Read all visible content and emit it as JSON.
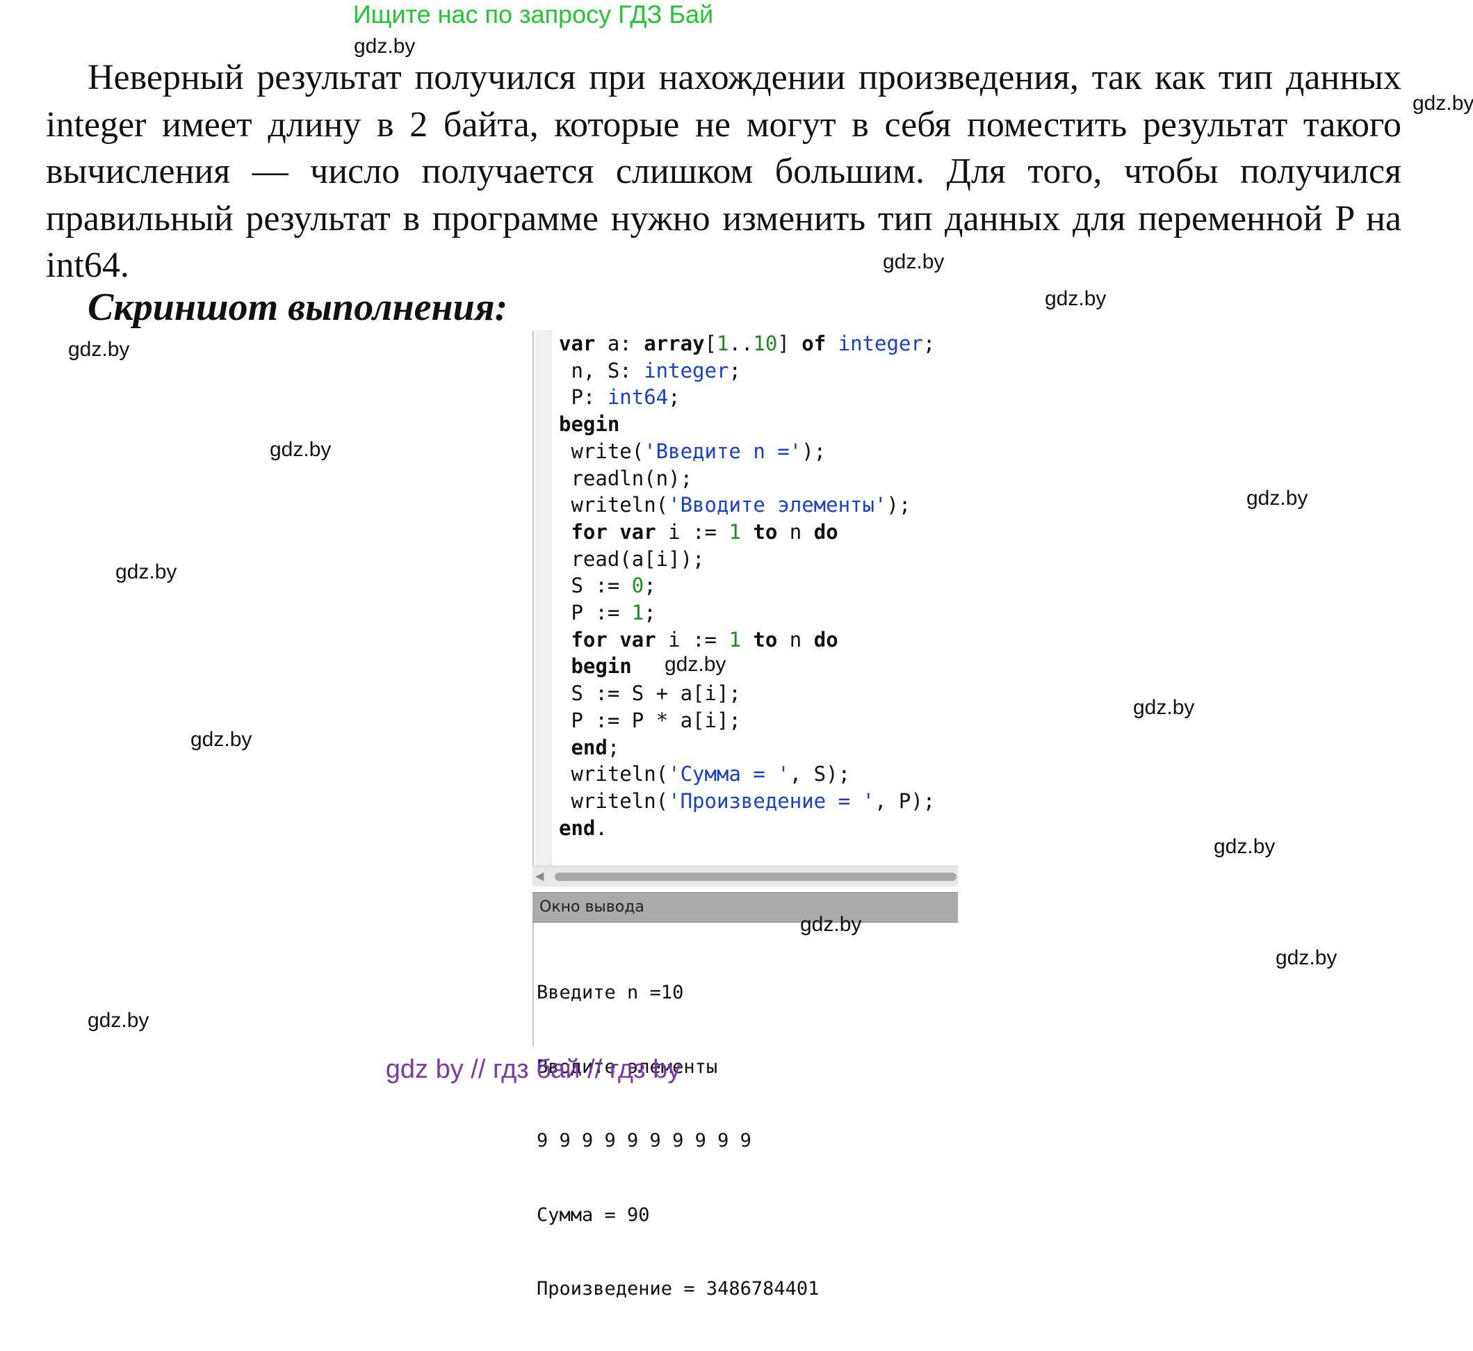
{
  "banner": "Ищите нас по запросу ГДЗ Бай",
  "watermark": "gdz.by",
  "paragraph": "Неверный результат получился при нахождении произведения, так как тип данных integer имеет длину в 2 байта, которые не могут в себя поместить результат такого вычисления — число получается слишком большим. Для того, чтобы получился правильный результат в программе нужно изменить тип данных для переменной P  на int64.",
  "heading": "Скриншот выполнения:",
  "code_lines": [
    "var a: array[1..10] of integer;",
    " n, S: integer;",
    " P: int64;",
    "begin",
    " write('Введите n =');",
    " readln(n);",
    " writeln('Вводите элементы');",
    " for var i := 1 to n do",
    " read(a[i]);",
    " S := 0;",
    " P := 1;",
    " for var i := 1 to n do",
    " begin",
    " S := S + a[i];",
    " P := P * a[i];",
    " end;",
    " writeln('Сумма = ', S);",
    " writeln('Произведение = ', P);",
    "end."
  ],
  "output_window": {
    "title": "Окно вывода",
    "lines": [
      "Введите n =10",
      "Вводите элементы",
      "9 9 9 9 9 9 9 9 9 9",
      "Сумма = 90",
      "Произведение = 3486784401"
    ]
  },
  "footer": "gdz by  //  гдз бай  //  гдз by"
}
